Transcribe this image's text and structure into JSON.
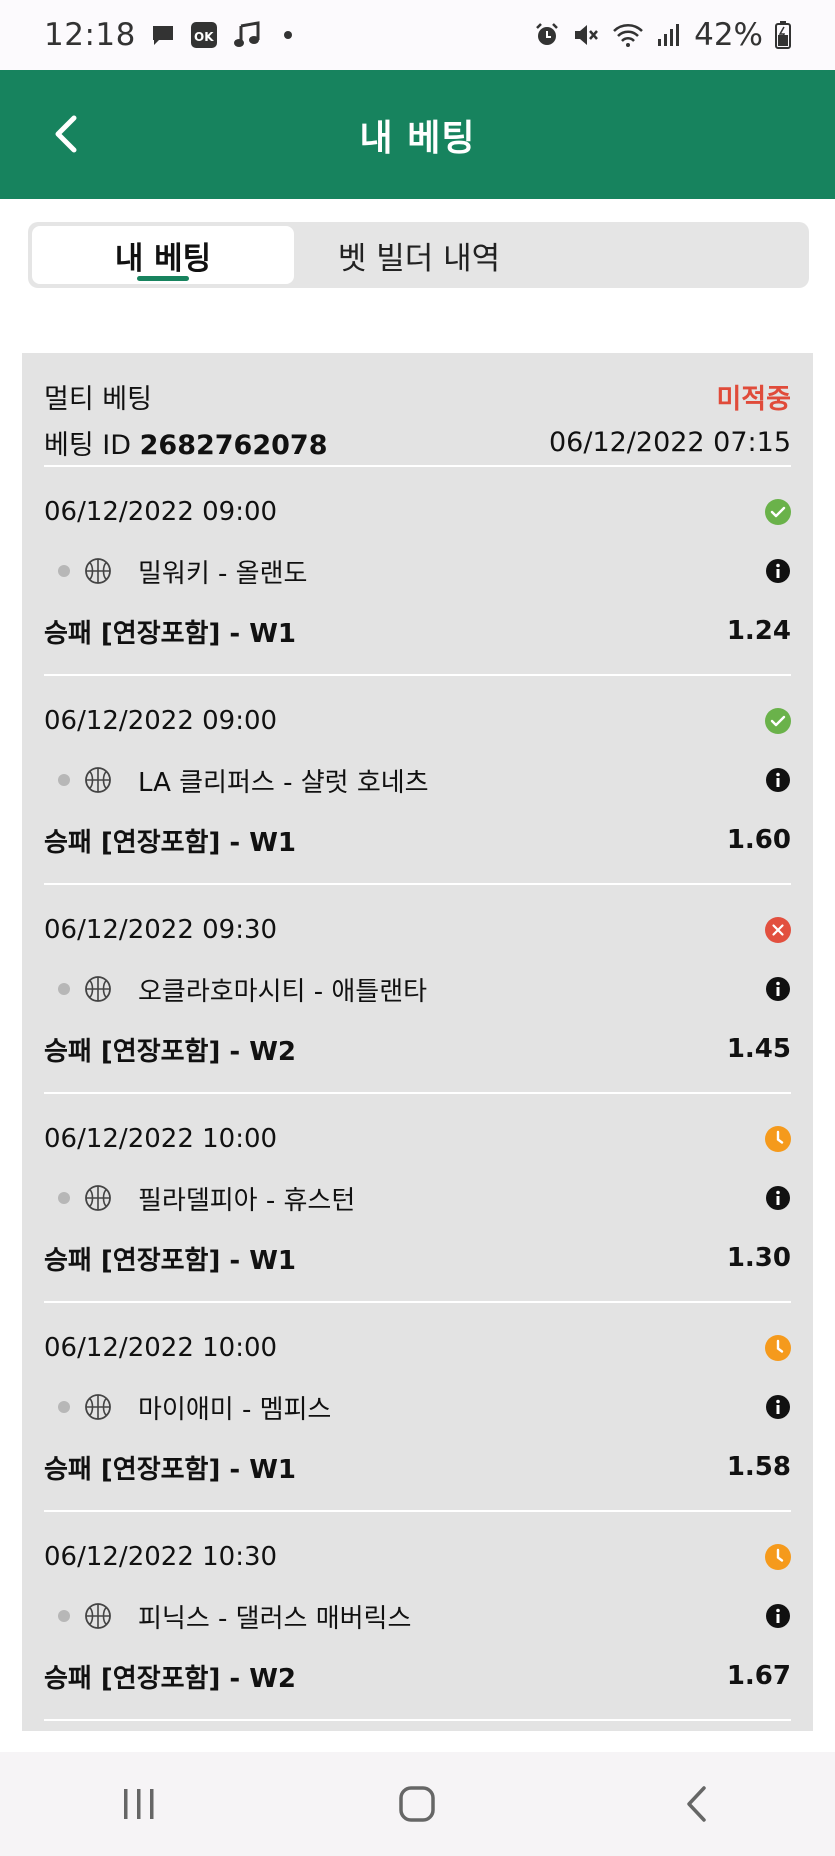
{
  "status_bar": {
    "time": "12:18",
    "battery": "42%"
  },
  "header": {
    "title": "내 베팅"
  },
  "tabs": [
    {
      "label": "내 베팅",
      "active": true
    },
    {
      "label": "벳 빌더 내역",
      "active": false
    }
  ],
  "bet": {
    "type": "멀티 베팅",
    "status": "미적중",
    "id_label": "베팅 ID",
    "id_value": "2682762078",
    "placed_at": "06/12/2022 07:15",
    "selections": [
      {
        "datetime": "06/12/2022 09:00",
        "match": "밀워키 - 올랜도",
        "market": "승패 [연장포함] - W1",
        "odds": "1.24",
        "result": "won"
      },
      {
        "datetime": "06/12/2022 09:00",
        "match": "LA 클리퍼스 - 샬럿 호네츠",
        "market": "승패 [연장포함] - W1",
        "odds": "1.60",
        "result": "won"
      },
      {
        "datetime": "06/12/2022 09:30",
        "match": "오클라호마시티 - 애틀랜타",
        "market": "승패 [연장포함] - W2",
        "odds": "1.45",
        "result": "lost"
      },
      {
        "datetime": "06/12/2022 10:00",
        "match": "필라델피아 - 휴스턴",
        "market": "승패 [연장포함] - W1",
        "odds": "1.30",
        "result": "pending"
      },
      {
        "datetime": "06/12/2022 10:00",
        "match": "마이애미 - 멤피스",
        "market": "승패 [연장포함] - W1",
        "odds": "1.58",
        "result": "pending"
      },
      {
        "datetime": "06/12/2022 10:30",
        "match": "피닉스 - 댈러스 매버릭스",
        "market": "승패 [연장포함] - W2",
        "odds": "1.67",
        "result": "pending"
      }
    ]
  },
  "colors": {
    "brand": "#17835e",
    "status_lost_text": "#e04b3a",
    "won": "#6ab24a",
    "lost": "#e2503f",
    "pending": "#f59a1c"
  }
}
